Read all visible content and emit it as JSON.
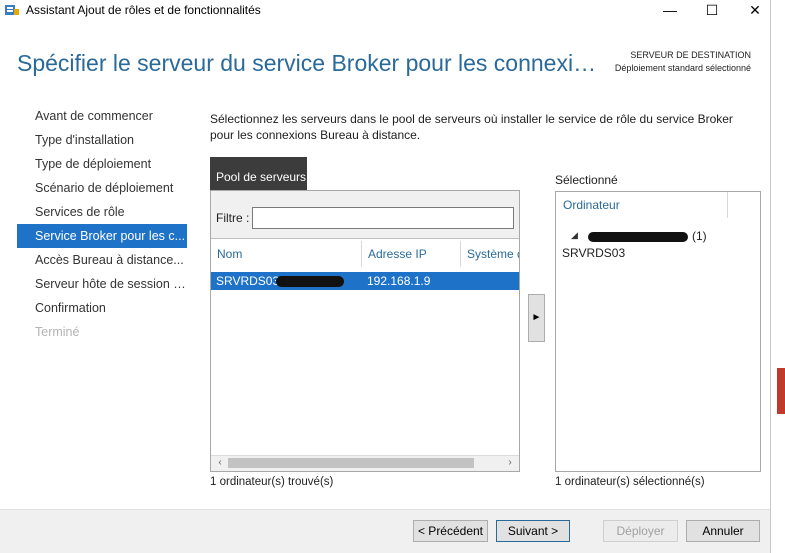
{
  "window": {
    "title": "Assistant Ajout de rôles et de fonctionnalités",
    "minimize": "—",
    "maximize": "☐",
    "close": "✕"
  },
  "header": {
    "heading": "Spécifier le serveur du service Broker pour les connexi…",
    "dest_label": "SERVEUR DE DESTINATION",
    "dest_value": "Déploiement standard sélectionné"
  },
  "nav": {
    "items": [
      {
        "label": "Avant de commencer",
        "state": "normal"
      },
      {
        "label": "Type d'installation",
        "state": "normal"
      },
      {
        "label": "Type de déploiement",
        "state": "normal"
      },
      {
        "label": "Scénario de déploiement",
        "state": "normal"
      },
      {
        "label": "Services de rôle",
        "state": "normal"
      },
      {
        "label": "Service Broker pour les c...",
        "state": "active"
      },
      {
        "label": "Accès Bureau à distance...",
        "state": "normal"
      },
      {
        "label": "Serveur hôte de session B...",
        "state": "normal"
      },
      {
        "label": "Confirmation",
        "state": "normal"
      },
      {
        "label": "Terminé",
        "state": "disabled"
      }
    ]
  },
  "description": "Sélectionnez les serveurs dans le pool de serveurs où installer le service de rôle du service Broker pour les connexions Bureau à distance.",
  "pool": {
    "tab_label": "Pool de serveurs",
    "filter_label": "Filtre :",
    "filter_value": "",
    "columns": [
      "Nom",
      "Adresse IP",
      "Système d"
    ],
    "rows": [
      {
        "name": "SRVRDS03.",
        "ip": "192.168.1.9",
        "os": ""
      }
    ],
    "count_text": "1 ordinateur(s) trouvé(s)"
  },
  "move_button": "►",
  "selected": {
    "label": "Sélectionné",
    "column": "Ordinateur",
    "group_count": "(1)",
    "server": "SRVRDS03",
    "count_text": "1 ordinateur(s) sélectionné(s)"
  },
  "buttons": {
    "previous": "< Précédent",
    "next": "Suivant >",
    "deploy": "Déployer",
    "cancel": "Annuler"
  },
  "colors": {
    "accent": "#1e73c8",
    "heading": "#2a6a9a",
    "tab": "#3c3c3c"
  }
}
